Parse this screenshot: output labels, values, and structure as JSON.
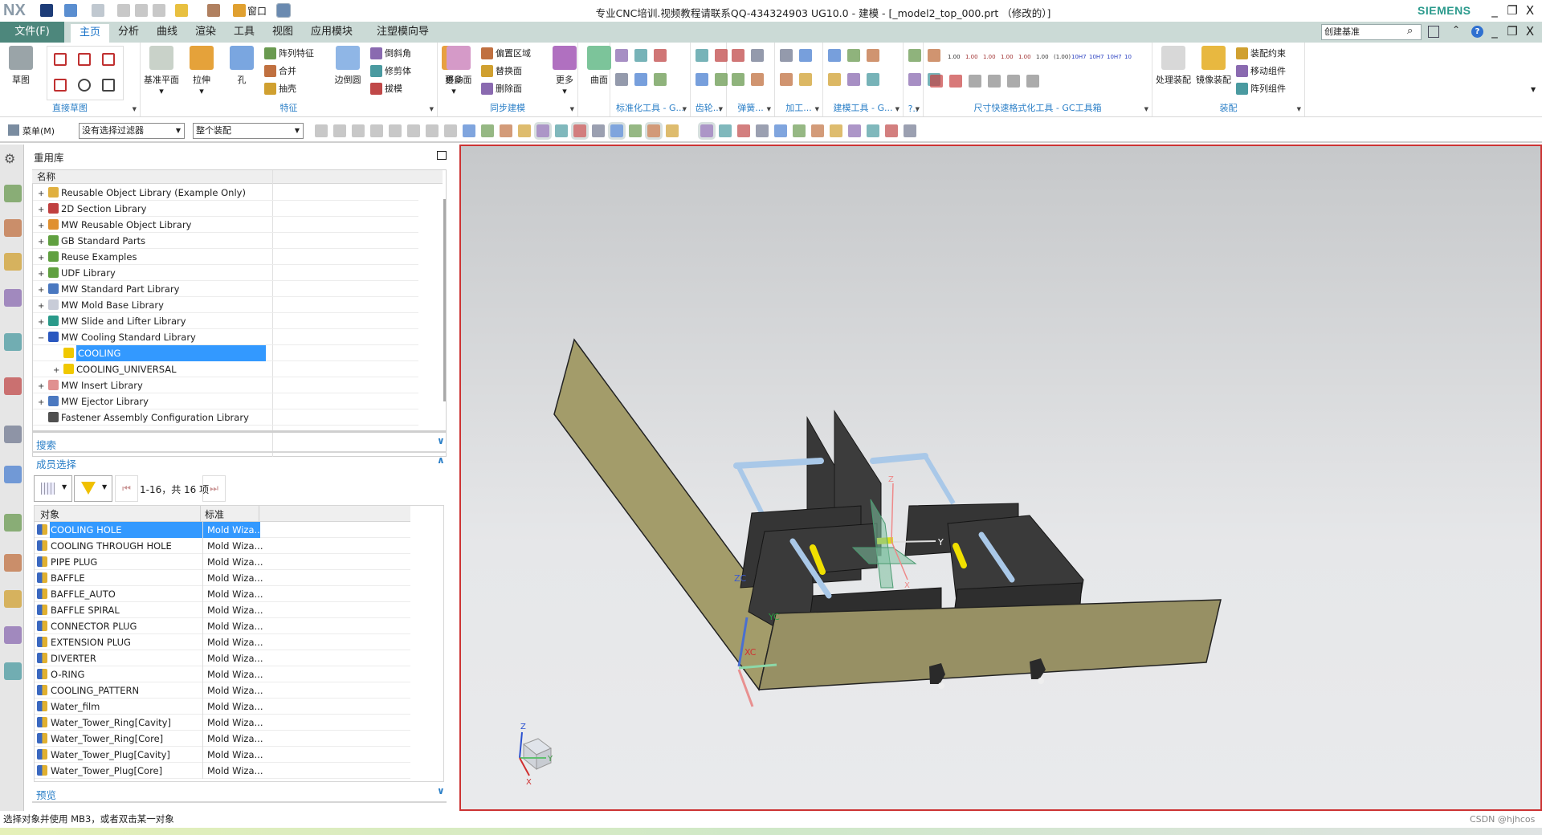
{
  "titlebar": {
    "logo": "NX",
    "title": "专业CNC培训.视频教程请联系QQ-434324903 UG10.0 - 建模 - [_model2_top_000.prt （修改的）]",
    "brand": "SIEMENS",
    "window_label": "窗口",
    "minimize": "_",
    "restore": "❐",
    "close": "X"
  },
  "tabs": {
    "file": "文件(F)",
    "items": [
      "主页",
      "分析",
      "曲线",
      "渲染",
      "工具",
      "视图",
      "应用模块",
      "注塑模向导"
    ],
    "active": 0,
    "search_value": "创建基准"
  },
  "ribbon": {
    "groups": [
      {
        "label": "直接草图",
        "big": [
          {
            "label": "草图",
            "color": "#9aa4a8"
          }
        ]
      },
      {
        "label": "特征",
        "big": [
          {
            "label": "基准平面",
            "color": "#c9d2c9"
          },
          {
            "label": "拉伸",
            "color": "#e5a23a"
          },
          {
            "label": "孔",
            "color": "#7aa6e0"
          },
          {
            "label": "边倒圆",
            "color": "#8fb6e6"
          },
          {
            "label": "更多",
            "color": "#e8a040"
          }
        ],
        "small": [
          "阵列特征",
          "合并",
          "抽壳",
          "倒斜角",
          "修剪体",
          "拔模"
        ]
      },
      {
        "label": "同步建模",
        "big": [
          {
            "label": "移动面",
            "color": "#d59ac8"
          },
          {
            "label": "更多",
            "color": "#b070c0"
          }
        ],
        "small": [
          "偏置区域",
          "替换面",
          "删除面"
        ]
      },
      {
        "label": "",
        "big": [
          {
            "label": "曲面",
            "color": "#7cc49a"
          }
        ]
      },
      {
        "label": "标准化工具 - G..."
      },
      {
        "label": "齿轮..."
      },
      {
        "label": "弹簧..."
      },
      {
        "label": "加工..."
      },
      {
        "label": "建模工具 - G..."
      },
      {
        "label": "?.."
      },
      {
        "label": "尺寸快速格式化工具 - GC工具箱",
        "dims": [
          "1.00",
          "1.00",
          "1.00",
          "1.00",
          "1.00",
          "1.00",
          "(1.00)",
          "10H7",
          "10H7",
          "10H7",
          "10"
        ]
      },
      {
        "label": "装配",
        "big": [
          {
            "label": "处理装配",
            "color": "#d8d8d8"
          },
          {
            "label": "镜像装配",
            "color": "#e8b840"
          }
        ],
        "small": [
          "装配约束",
          "移动组件",
          "阵列组件"
        ]
      }
    ]
  },
  "toolbar": {
    "menu": "菜单(M)",
    "filter": "没有选择过滤器",
    "scope": "整个装配"
  },
  "panel": {
    "title": "重用库",
    "tree_header": "名称",
    "tree": [
      {
        "label": "Reusable Object Library (Example Only)",
        "exp": "+",
        "level": 0,
        "color": "#e0b040"
      },
      {
        "label": "2D Section Library",
        "exp": "+",
        "level": 0,
        "color": "#c04040"
      },
      {
        "label": "MW Reusable Object Library",
        "exp": "+",
        "level": 0,
        "color": "#e09030"
      },
      {
        "label": "GB Standard Parts",
        "exp": "+",
        "level": 0,
        "color": "#60a040"
      },
      {
        "label": "Reuse Examples",
        "exp": "+",
        "level": 0,
        "color": "#60a040"
      },
      {
        "label": "UDF Library",
        "exp": "+",
        "level": 0,
        "color": "#60a040"
      },
      {
        "label": "MW Standard Part Library",
        "exp": "+",
        "level": 0,
        "color": "#4a78c0"
      },
      {
        "label": "MW Mold Base Library",
        "exp": "+",
        "level": 0,
        "color": "#c8ccd8"
      },
      {
        "label": "MW Slide and Lifter Library",
        "exp": "+",
        "level": 0,
        "color": "#2a9a8a"
      },
      {
        "label": "MW Cooling Standard Library",
        "exp": "-",
        "level": 0,
        "color": "#2a58c0"
      },
      {
        "label": "COOLING",
        "exp": "",
        "level": 1,
        "color": "#f0c800",
        "selected": true
      },
      {
        "label": "COOLING_UNIVERSAL",
        "exp": "+",
        "level": 1,
        "color": "#f0c800"
      },
      {
        "label": "MW Insert Library",
        "exp": "+",
        "level": 0,
        "color": "#e09090"
      },
      {
        "label": "MW Ejector Library",
        "exp": "+",
        "level": 0,
        "color": "#4a78c0"
      },
      {
        "label": "Fastener Assembly Configuration Library",
        "exp": "",
        "level": 0,
        "color": "#505050"
      }
    ],
    "search_label": "搜索",
    "member_label": "成员选择",
    "pager": "1-16，共 16 项",
    "columns": [
      "对象",
      "标准"
    ],
    "members": [
      "COOLING HOLE",
      "COOLING THROUGH HOLE",
      "PIPE PLUG",
      "BAFFLE",
      "BAFFLE_AUTO",
      "BAFFLE SPIRAL",
      "CONNECTOR PLUG",
      "EXTENSION PLUG",
      "DIVERTER",
      "O-RING",
      "COOLING_PATTERN",
      "Water_film",
      "Water_Tower_Ring[Cavity]",
      "Water_Tower_Ring[Core]",
      "Water_Tower_Plug[Cavity]",
      "Water_Tower_Plug[Core]"
    ],
    "standard": "Mold Wiza...",
    "preview_label": "预览"
  },
  "viewport": {
    "axes": {
      "zc": "ZC",
      "yc": "YC",
      "xc": "XC",
      "x": "X",
      "y": "Y",
      "z": "Z"
    },
    "colors": {
      "plate": "#9f9868",
      "box": "#3a3a3a",
      "rod": "#a9c8e8",
      "pin": "#f0e000"
    }
  },
  "status": {
    "text": "选择对象并使用 MB3，或者双击某一对象",
    "watermark": "CSDN @hjhcos"
  }
}
